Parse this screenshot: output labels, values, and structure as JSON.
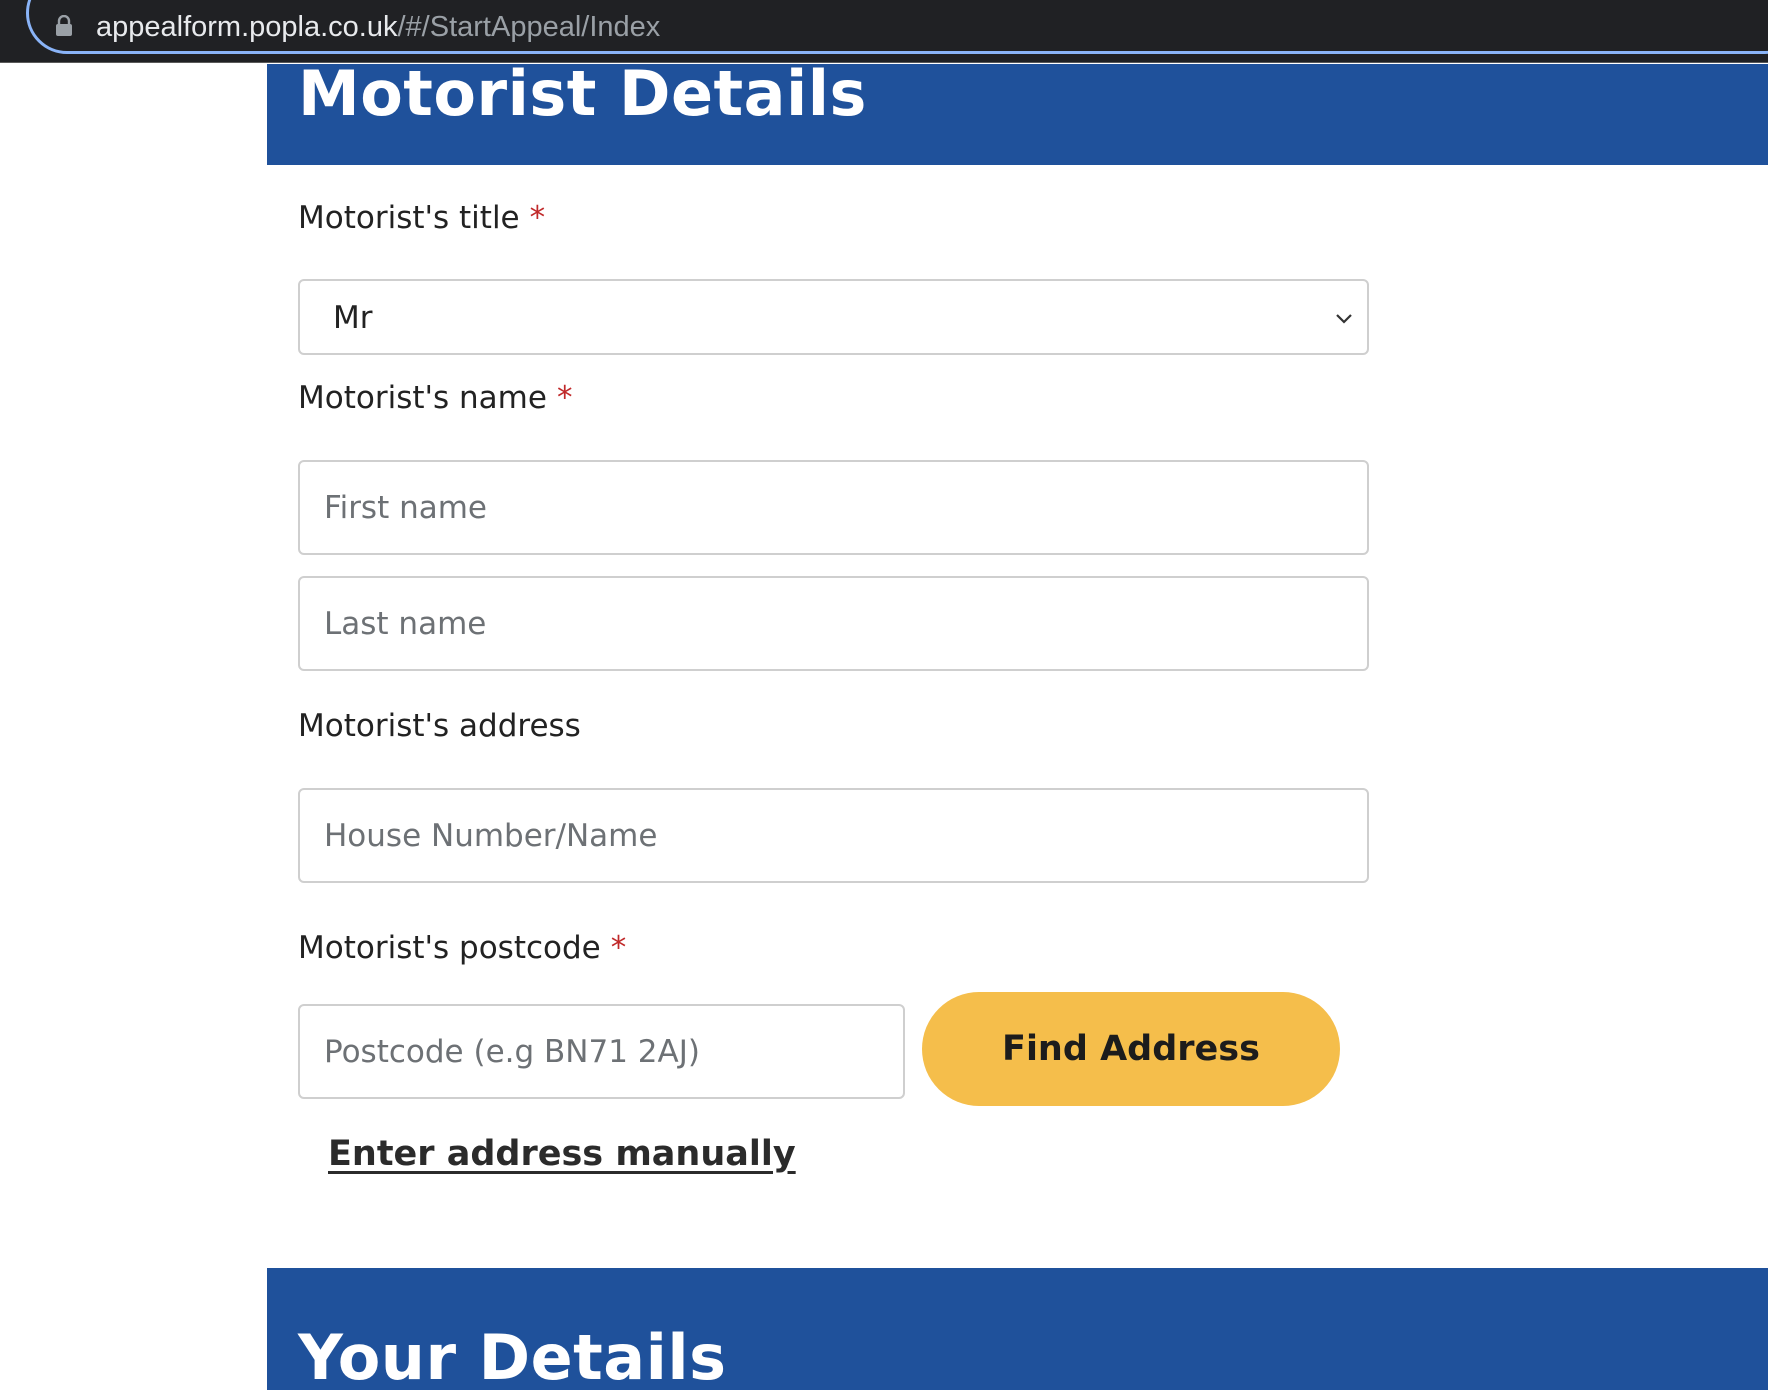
{
  "browser": {
    "url_domain": "appealform.popla.co.uk",
    "url_path": "/#/StartAppeal/Index"
  },
  "sections": {
    "motorist_details_title": "Motorist Details",
    "your_details_title": "Your Details"
  },
  "form": {
    "title_label": "Motorist's title",
    "title_value": "Mr",
    "name_label": "Motorist's name",
    "first_name_placeholder": "First name",
    "last_name_placeholder": "Last name",
    "address_label": "Motorist's address",
    "house_placeholder": "House Number/Name",
    "postcode_label": "Motorist's postcode",
    "postcode_placeholder": "Postcode (e.g BN71 2AJ)",
    "required_marker": "*",
    "find_address_label": "Find Address",
    "enter_manually_label": "Enter address manually"
  },
  "colors": {
    "header_blue": "#1f519b",
    "button_yellow": "#f5be4b",
    "required_red": "#c0292a"
  }
}
